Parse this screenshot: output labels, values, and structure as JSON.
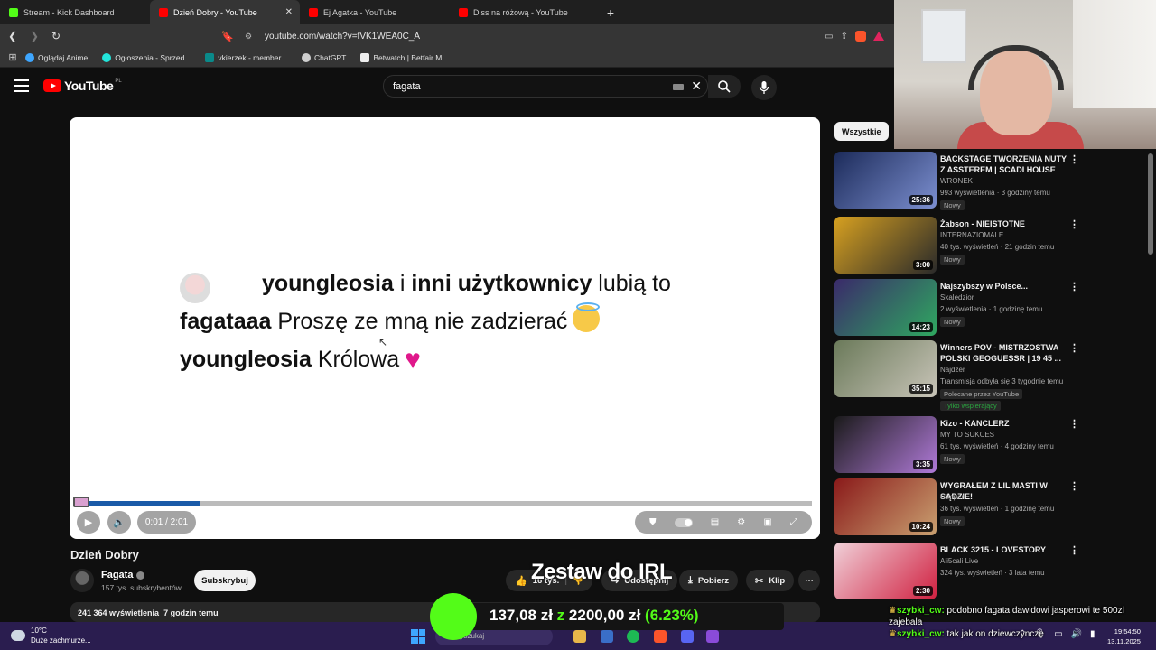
{
  "browser": {
    "tabs": [
      {
        "label": "Stream - Kick Dashboard",
        "color": "#53fc18"
      },
      {
        "label": "Dzień Dobry - YouTube",
        "color": "#ff0000"
      },
      {
        "label": "Ej Agatka - YouTube",
        "color": "#ff0000"
      },
      {
        "label": "Diss na różową - YouTube",
        "color": "#ff0000"
      }
    ],
    "new_tab": "+",
    "url": "youtube.com/watch?v=fVK1WEA0C_A",
    "bookmarks": [
      {
        "label": "Oglądaj Anime"
      },
      {
        "label": "Ogłoszenia - Sprzed..."
      },
      {
        "label": "vkierzek - member..."
      },
      {
        "label": "ChatGPT"
      },
      {
        "label": "Betwatch | Betfair M..."
      }
    ]
  },
  "youtube": {
    "logo_text": "YouTube",
    "country_code": "PL",
    "search_value": "fagata"
  },
  "video": {
    "comment": {
      "line1_user": "youngleosia",
      "line1_mid": " i ",
      "line1_bold2": "inni użytkownicy",
      "line1_tail": " lubią to",
      "line2_user": "fagataaa",
      "line2_text": " Proszę ze mną nie zadzierać",
      "line3_user": "youngleosia",
      "line3_text": " Królowa"
    },
    "progress_fraction": 0.17,
    "time": "0:01 / 2:01",
    "title": "Dzień Dobry",
    "channel": "Fagata",
    "subscribers": "157 tys. subskrybentów",
    "subscribe_label": "Subskrybuj",
    "like_label": "16 tys.",
    "share_label": "Udostępnij",
    "download_label": "Pobierz",
    "clip_label": "Klip",
    "more_label": "⋯",
    "views": "241 364 wyświetlenia",
    "uploaded": "7 godzin temu"
  },
  "sidebar": {
    "chip": "Wszystkie",
    "items": [
      {
        "title": "BACKSTAGE TWORZENIA NUTY Z ASSTEREM | SCADI HOUSE",
        "channel": "WRONEK",
        "meta": "993 wyświetlenia · 3 godziny temu",
        "badge": "Nowy",
        "duration": "25:36",
        "colors": [
          "#1c2b5a",
          "#7c8fd0"
        ]
      },
      {
        "title": "Żabson - NIEISTOTNE",
        "channel": "INTERNAZIOMALE",
        "meta": "40 tys. wyświetleń · 21 godzin temu",
        "badge": "Nowy",
        "duration": "3:00",
        "colors": [
          "#d6a020",
          "#2a2a2a"
        ]
      },
      {
        "title": "Najszybszy w Polsce...",
        "channel": "Skaledzior",
        "meta": "2 wyświetlenia · 1 godzinę temu",
        "badge": "Nowy",
        "duration": "14:23",
        "colors": [
          "#3a2a6a",
          "#2fa860"
        ]
      },
      {
        "title": "Winners POV - MISTRZOSTWA POLSKI GEOGUESSR | 19 45 ...",
        "channel": "Najdżer",
        "meta": "Transmisja odbyła się 3 tygodnie temu",
        "badge": "Polecane przez YouTube",
        "badge2": "Tylko wspierający",
        "duration": "35:15",
        "colors": [
          "#6b7a5a",
          "#c8c4b8"
        ]
      },
      {
        "title": "Kizo - KANCLERZ",
        "channel": "MY TO SUKCES",
        "meta": "61 tys. wyświetleń · 4 godziny temu",
        "badge": "Nowy",
        "duration": "3:35",
        "colors": [
          "#1a1a1a",
          "#b07ad8"
        ]
      },
      {
        "title": "WYGRAŁEM Z LIL MASTI W SĄDZIE!",
        "channel": "Gimper",
        "meta": "36 tys. wyświetleń · 1 godzinę temu",
        "badge": "Nowy",
        "duration": "10:24",
        "colors": [
          "#8a1a1a",
          "#c9a070"
        ]
      },
      {
        "title": "BLACK 3215 - LOVESTORY",
        "channel": "Ali5cali Live",
        "meta": "324 tys. wyświetleń · 3 lata temu",
        "badge": "",
        "duration": "2:30",
        "colors": [
          "#f0d0d8",
          "#d02040"
        ]
      }
    ]
  },
  "overlay": {
    "title": "Zestaw do IRL",
    "donation_current": "137,08 zł",
    "donation_sep": " z ",
    "donation_goal": "2200,00 zł",
    "donation_pct": " (6.23%)"
  },
  "chat": [
    {
      "user": "szybki_cw:",
      "text": " podobno fagata dawidowi jasperowi te 500zl zajebala"
    },
    {
      "user": "szybki_cw:",
      "text": " tak jak on dziewczyncze"
    }
  ],
  "taskbar": {
    "temp": "10°C",
    "weather": "Duże zachmurze...",
    "search_placeholder": "Wyszukaj",
    "time": "19:54:50",
    "date": "13.11.2025"
  }
}
